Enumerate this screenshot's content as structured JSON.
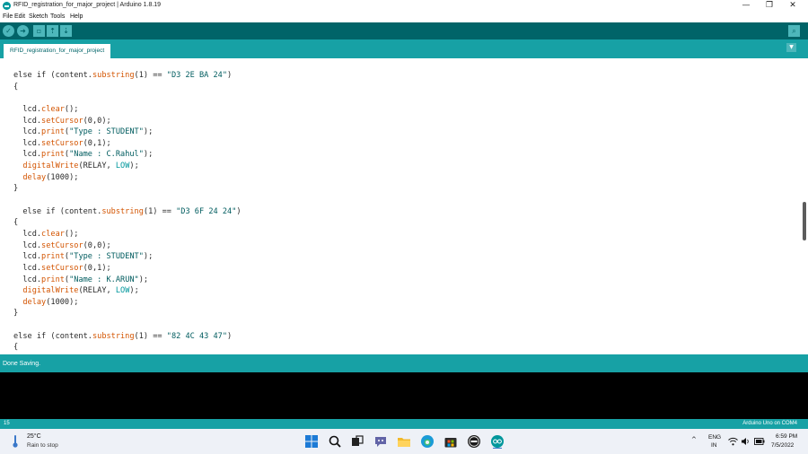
{
  "window": {
    "title": "RFID_registration_for_major_project | Arduino 1.8.19",
    "app_icon": "arduino-icon",
    "controls": {
      "minimize": "—",
      "maximize": "❐",
      "close": "✕"
    }
  },
  "menu": [
    "File",
    "Edit",
    "Sketch",
    "Tools",
    "Help"
  ],
  "toolbar": {
    "buttons": [
      {
        "icon": "verify-icon",
        "glyph": "✓"
      },
      {
        "icon": "upload-icon",
        "glyph": "➜"
      },
      {
        "icon": "new-icon",
        "glyph": "▫"
      },
      {
        "icon": "open-icon",
        "glyph": "⇡"
      },
      {
        "icon": "save-icon",
        "glyph": "⇣"
      }
    ],
    "serial_monitor": {
      "icon": "serial-monitor-icon",
      "glyph": "⌕"
    }
  },
  "tab": {
    "label": "RFID_registration_for_major_project",
    "menu_glyph": "▼"
  },
  "editor": {
    "lines": [
      [
        [
          "",
          "else if (content."
        ],
        [
          "fn",
          "substring"
        ],
        [
          "",
          "(1) == "
        ],
        [
          "str",
          "\"D3 2E BA 24\""
        ],
        [
          "",
          ")"
        ]
      ],
      [
        [
          "",
          "{"
        ]
      ],
      [
        [
          "",
          ""
        ]
      ],
      [
        [
          "",
          "  lcd."
        ],
        [
          "fn",
          "clear"
        ],
        [
          "",
          "();"
        ]
      ],
      [
        [
          "",
          "  lcd."
        ],
        [
          "fn",
          "setCursor"
        ],
        [
          "",
          "(0,0);"
        ]
      ],
      [
        [
          "",
          "  lcd."
        ],
        [
          "fn",
          "print"
        ],
        [
          "",
          "("
        ],
        [
          "str",
          "\"Type : STUDENT\""
        ],
        [
          "",
          ");"
        ]
      ],
      [
        [
          "",
          "  lcd."
        ],
        [
          "fn",
          "setCursor"
        ],
        [
          "",
          "(0,1);"
        ]
      ],
      [
        [
          "",
          "  lcd."
        ],
        [
          "fn",
          "print"
        ],
        [
          "",
          "("
        ],
        [
          "str",
          "\"Name : C.Rahul\""
        ],
        [
          "",
          ");"
        ]
      ],
      [
        [
          "",
          "  "
        ],
        [
          "fn",
          "digitalWrite"
        ],
        [
          "",
          "(RELAY, "
        ],
        [
          "const",
          "LOW"
        ],
        [
          "",
          ");"
        ]
      ],
      [
        [
          "",
          "  "
        ],
        [
          "fn",
          "delay"
        ],
        [
          "",
          "(1000);"
        ]
      ],
      [
        [
          "",
          "}"
        ]
      ],
      [
        [
          "",
          ""
        ]
      ],
      [
        [
          "",
          "  else if (content."
        ],
        [
          "fn",
          "substring"
        ],
        [
          "",
          "(1) == "
        ],
        [
          "str",
          "\"D3 6F 24 24\""
        ],
        [
          "",
          ")"
        ]
      ],
      [
        [
          "",
          "{"
        ]
      ],
      [
        [
          "",
          "  lcd."
        ],
        [
          "fn",
          "clear"
        ],
        [
          "",
          "();"
        ]
      ],
      [
        [
          "",
          "  lcd."
        ],
        [
          "fn",
          "setCursor"
        ],
        [
          "",
          "(0,0);"
        ]
      ],
      [
        [
          "",
          "  lcd."
        ],
        [
          "fn",
          "print"
        ],
        [
          "",
          "("
        ],
        [
          "str",
          "\"Type : STUDENT\""
        ],
        [
          "",
          ");"
        ]
      ],
      [
        [
          "",
          "  lcd."
        ],
        [
          "fn",
          "setCursor"
        ],
        [
          "",
          "(0,1);"
        ]
      ],
      [
        [
          "",
          "  lcd."
        ],
        [
          "fn",
          "print"
        ],
        [
          "",
          "("
        ],
        [
          "str",
          "\"Name : K.ARUN\""
        ],
        [
          "",
          ");"
        ]
      ],
      [
        [
          "",
          "  "
        ],
        [
          "fn",
          "digitalWrite"
        ],
        [
          "",
          "(RELAY, "
        ],
        [
          "const",
          "LOW"
        ],
        [
          "",
          ");"
        ]
      ],
      [
        [
          "",
          "  "
        ],
        [
          "fn",
          "delay"
        ],
        [
          "",
          "(1000);"
        ]
      ],
      [
        [
          "",
          "}"
        ]
      ],
      [
        [
          "",
          ""
        ]
      ],
      [
        [
          "",
          "else if (content."
        ],
        [
          "fn",
          "substring"
        ],
        [
          "",
          "(1) == "
        ],
        [
          "str",
          "\"82 4C 43 47\""
        ],
        [
          "",
          ")"
        ]
      ],
      [
        [
          "",
          "{"
        ]
      ]
    ]
  },
  "status": {
    "message": "Done Saving."
  },
  "footer": {
    "line_number": "15",
    "board": "Arduino Uno on COM4"
  },
  "taskbar": {
    "weather": {
      "temp": "25°C",
      "desc": "Rain to stop",
      "icon": "weather-rain-icon"
    },
    "apps": [
      "windows-start-icon",
      "search-icon",
      "task-view-icon",
      "teams-chat-icon",
      "file-explorer-icon",
      "edge-browser-icon",
      "microsoft-store-icon",
      "dell-icon",
      "arduino-taskbar-icon"
    ],
    "tray": {
      "chevron": "^",
      "lang_top": "ENG",
      "lang_bottom": "IN",
      "icons": [
        "wifi-icon",
        "volume-icon",
        "battery-icon"
      ],
      "time": "6:59 PM",
      "date": "7/5/2022"
    }
  }
}
